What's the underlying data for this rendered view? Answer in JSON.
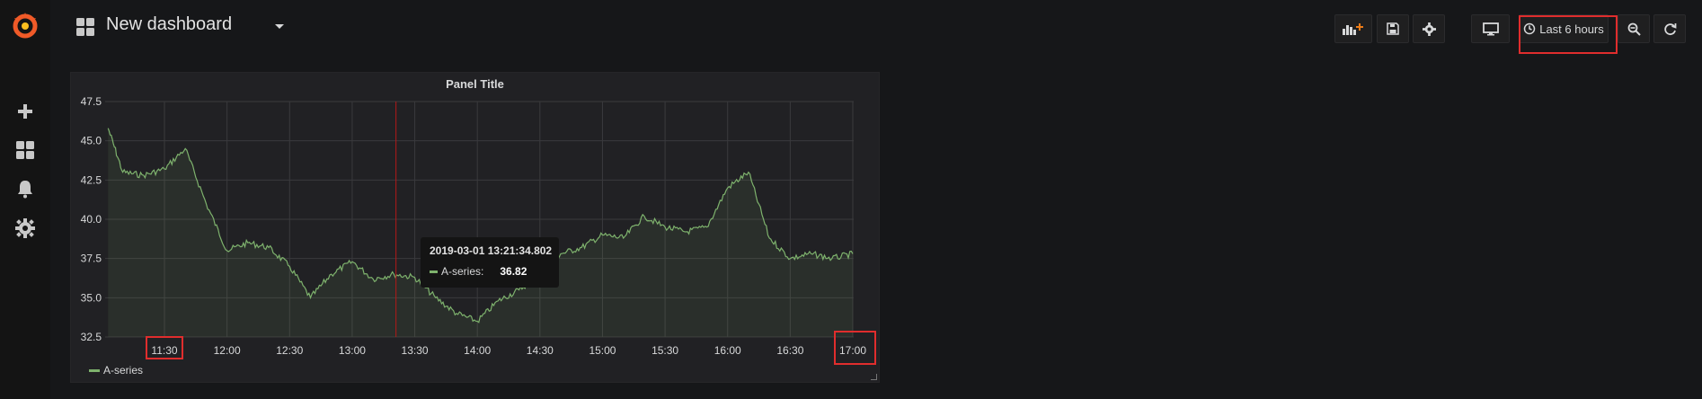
{
  "dashboard": {
    "title": "New dashboard"
  },
  "toolbar": {
    "add_panel_icon": "add-panel-icon",
    "save_icon": "save-icon",
    "settings_icon": "gear-icon",
    "tv_mode_icon": "monitor-icon",
    "time_range_label": "Last 6 hours",
    "zoom_out_icon": "zoom-out-icon",
    "refresh_icon": "refresh-icon"
  },
  "sidebar": {
    "items": [
      {
        "icon": "plus-icon"
      },
      {
        "icon": "dashboards-icon"
      },
      {
        "icon": "bell-icon"
      },
      {
        "icon": "gear-icon"
      }
    ]
  },
  "panel": {
    "title": "Panel Title",
    "tooltip": {
      "time": "2019-03-01 13:21:34.802",
      "series": "A-series:",
      "value": "36.82"
    },
    "legend": [
      "A-series"
    ]
  },
  "colors": {
    "series": "#7eb26d",
    "highlight": "#e02d2d"
  },
  "chart_data": {
    "type": "area",
    "ylim": [
      32.5,
      47.5
    ],
    "yticks": [
      "32.5",
      "35.0",
      "37.5",
      "40.0",
      "42.5",
      "45.0",
      "47.5"
    ],
    "xticks": [
      "11:30",
      "12:00",
      "12:30",
      "13:00",
      "13:30",
      "14:00",
      "14:30",
      "15:00",
      "15:30",
      "16:00",
      "16:30",
      "17:00"
    ],
    "series": [
      {
        "name": "A-series",
        "x": [
          "11:03",
          "11:10",
          "11:20",
          "11:30",
          "11:40",
          "11:50",
          "12:00",
          "12:10",
          "12:20",
          "12:30",
          "12:40",
          "12:50",
          "13:00",
          "13:10",
          "13:20",
          "13:30",
          "13:40",
          "13:50",
          "14:00",
          "14:10",
          "14:20",
          "14:30",
          "14:40",
          "14:50",
          "15:00",
          "15:10",
          "15:20",
          "15:30",
          "15:40",
          "15:50",
          "16:00",
          "16:10",
          "16:20",
          "16:30",
          "16:40",
          "16:50",
          "17:00"
        ],
        "values": [
          45.8,
          43.0,
          42.8,
          43.2,
          44.5,
          41.0,
          38.0,
          38.5,
          38.2,
          37.0,
          35.0,
          36.5,
          37.3,
          36.2,
          36.5,
          36.3,
          35.0,
          34.0,
          33.5,
          34.8,
          35.5,
          36.5,
          37.8,
          38.2,
          39.0,
          38.8,
          40.2,
          39.5,
          39.2,
          39.5,
          42.0,
          43.0,
          38.8,
          37.5,
          37.8,
          37.5,
          37.8
        ]
      }
    ]
  }
}
